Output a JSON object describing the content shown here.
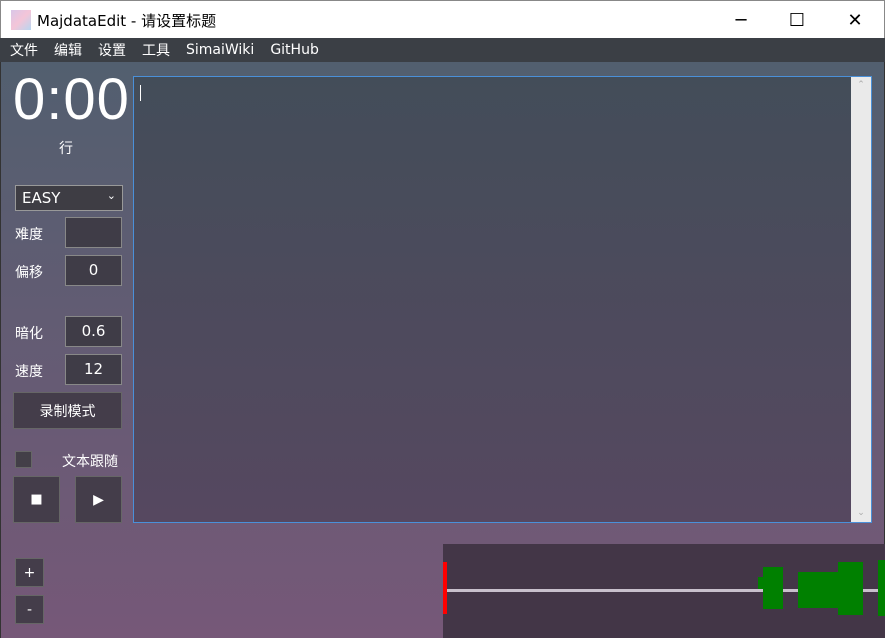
{
  "window": {
    "title": "MajdataEdit - 请设置标题",
    "minimize": "─",
    "maximize": "☐",
    "close": "✕"
  },
  "menu": [
    "文件",
    "编辑",
    "设置",
    "工具",
    "SimaiWiki",
    "GitHub"
  ],
  "time": "0:00",
  "row_label": "行",
  "difficulty_select": "EASY",
  "fields": {
    "level_label": "难度",
    "level_value": "",
    "offset_label": "偏移",
    "offset_value": "0",
    "dim_label": "暗化",
    "dim_value": "0.6",
    "speed_label": "速度",
    "speed_value": "12"
  },
  "record_button": "录制模式",
  "follow_text_label": "文本跟随",
  "follow_text_checked": false,
  "stop_icon": "■",
  "play_icon": "▶",
  "zoom_in": "+",
  "zoom_out": "-",
  "editor_text": "",
  "colors": {
    "cursor": "#ff0000",
    "waveform": "#008000",
    "editor_border": "#4a90d9"
  }
}
